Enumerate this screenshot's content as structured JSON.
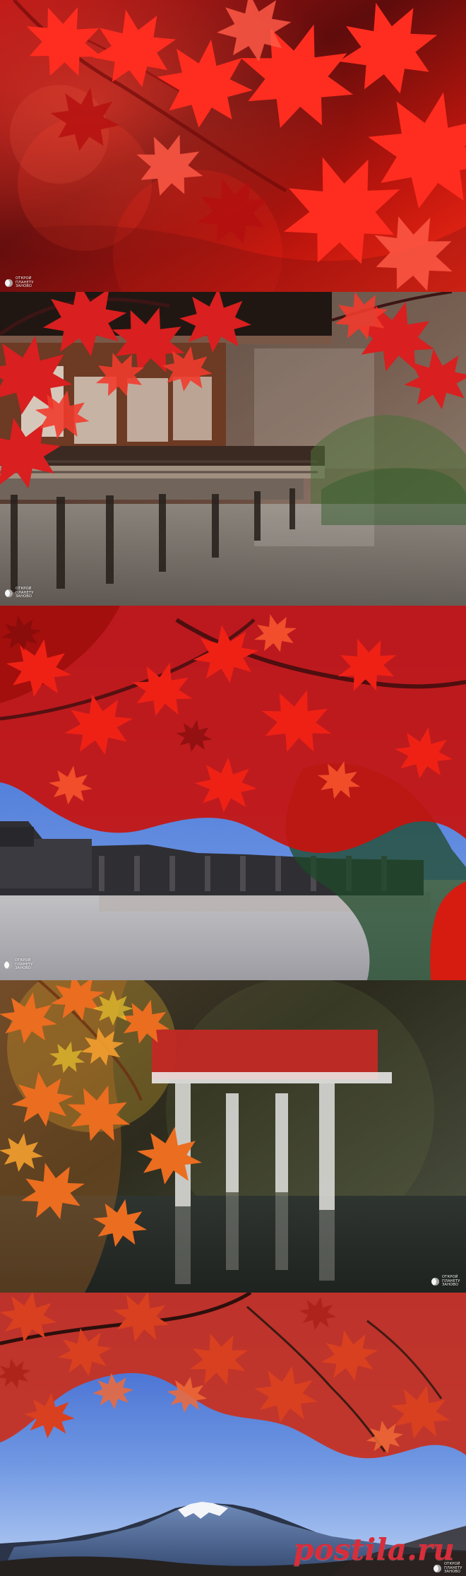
{
  "watermark": {
    "line1": "ОТКРОЙ",
    "line2": "ПЛАНЕТУ",
    "line3": "ЗАНОВО"
  },
  "brand": {
    "name": "postila",
    "tld": ".ru"
  },
  "colors": {
    "red_leaf": "#d9261f",
    "orange_leaf": "#e6561a",
    "sky_blue": "#3f6bc6",
    "brand_red": "#d82d3a"
  }
}
